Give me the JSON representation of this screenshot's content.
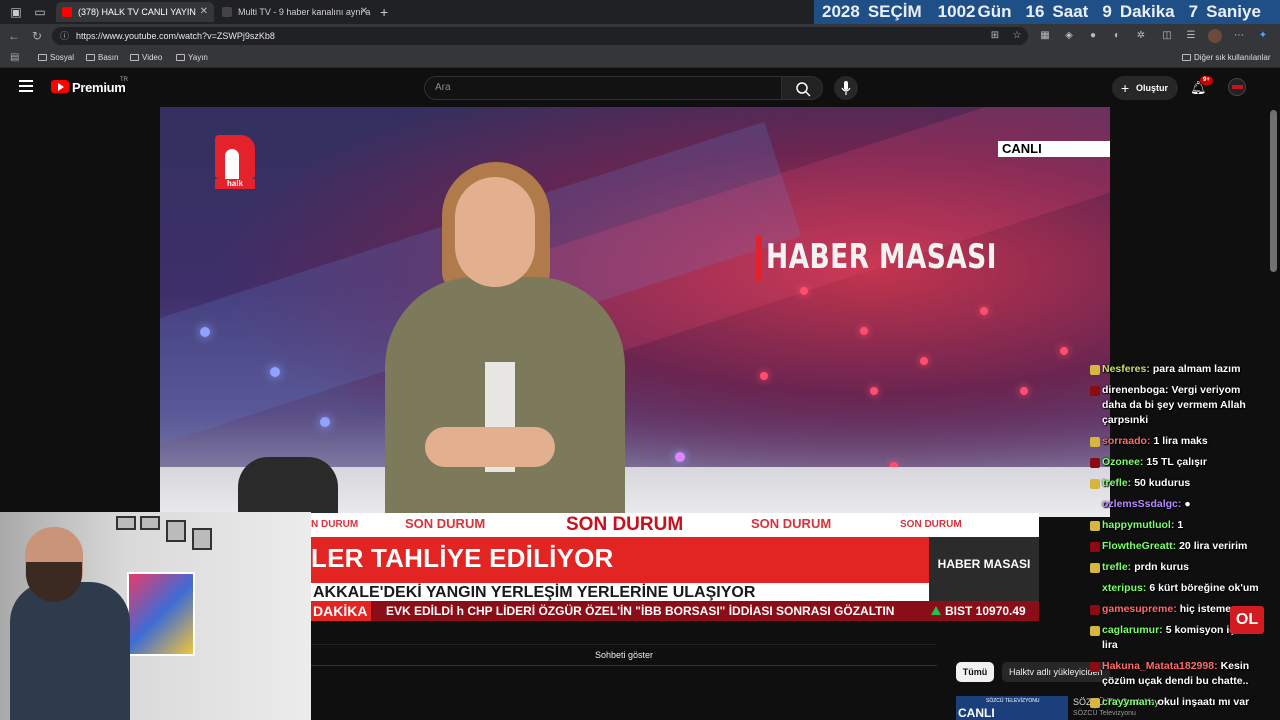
{
  "browser": {
    "tabs": [
      {
        "title": "(378) HALK TV CANLI YAYIN",
        "active": true,
        "favicon_color": "#ff0000"
      },
      {
        "title": "Multi TV - 9 haber kanalını aynı a",
        "active": false,
        "favicon_color": "#333333"
      }
    ],
    "new_tab": "+",
    "url": "https://www.youtube.com/watch?v=ZSWPj9szKb8",
    "bookmarks": [
      "Sosyal",
      "Basın",
      "Video",
      "Yayın"
    ],
    "other_bookmarks": "Diğer sık kullanılanlar"
  },
  "countdown": {
    "year": "2028",
    "label": "SEÇİM",
    "days": "1002",
    "days_label": "Gün",
    "hours": "16",
    "hours_label": "Saat",
    "minutes": "9",
    "minutes_label": "Dakika",
    "seconds": "7",
    "seconds_label": "Saniye"
  },
  "youtube": {
    "brand": "Premium",
    "region": "TR",
    "search_placeholder": "Ara",
    "create_label": "Oluştur",
    "notifications": "9+",
    "show_chat": "Sohbeti göster",
    "chips": [
      "Tümü",
      "Halktv adlı yükleyiciden"
    ],
    "recommendation": {
      "thumb_text": "CANLI",
      "thumb_small": "SÖZCÜ TELEVİZYONU",
      "title": "SÖZCÜ TV Canlı Yayını ᐧ",
      "channel": "SÖZCÜ Televizyonu"
    }
  },
  "broadcast": {
    "logo_word": "halk",
    "live_label": "CANLI",
    "program": "HABER MASASI",
    "son_durum": [
      "N DURUM",
      "SON DURUM",
      "SON DURUM",
      "SON DURUM",
      "SON DURUM"
    ],
    "headline": "LER TAHLİYE EDİLİYOR",
    "subline": "AKKALE'DEKİ YANGIN YERLEŞİM YERLERİNE ULAŞIYOR",
    "lower_logo": "HABER MASASI",
    "ticker_label": "DAKİKA",
    "ticker_text": "EVK EDİLDİ   h   CHP LİDERİ ÖZGÜR ÖZEL'İN \"İBB BORSASI\" İDDİASI SONRASI GÖZALTIN",
    "bist": "BIST 10970.49"
  },
  "chat": [
    {
      "user": "Nesferes:",
      "text": "para almam lazım",
      "badge": "gold",
      "color": "#c6e06a"
    },
    {
      "user": "direnenboga:",
      "text": "Vergi veriyom daha da bi şey vermem Allah çarpsınki",
      "badge": "red",
      "color": "#ffffff"
    },
    {
      "user": "sorraado:",
      "text": "1 lira maks",
      "badge": "gold",
      "color": "#ff6b6b"
    },
    {
      "user": "Ozonee:",
      "text": "15 TL çalışır",
      "badge": "red",
      "color": "#7cff6b"
    },
    {
      "user": "trefle:",
      "text": "50 kudurus",
      "badge": "gold",
      "color": "#7cff6b"
    },
    {
      "user": "ozlemsSsdalgc:",
      "text": "●",
      "badge": "none",
      "color": "#b78bff"
    },
    {
      "user": "happymutluol:",
      "text": "1",
      "badge": "gold",
      "color": "#7cff6b"
    },
    {
      "user": "FlowtheGreatt:",
      "text": "20 lira veririm",
      "badge": "red",
      "color": "#7cff6b"
    },
    {
      "user": "trefle:",
      "text": "prdn kurus",
      "badge": "gold",
      "color": "#7cff6b"
    },
    {
      "user": "xteripus:",
      "text": "6 kürt böreğine ok'um",
      "badge": "none",
      "color": "#7cff6b"
    },
    {
      "user": "gamesupreme:",
      "text": "hiç istemem",
      "badge": "red",
      "color": "#ff6b6b"
    },
    {
      "user": "caglarumur:",
      "text": "5 komisyon için 1 lira",
      "badge": "gold",
      "color": "#7cff6b"
    },
    {
      "user": "Hakuna_Matata182998:",
      "text": "Kesin çözüm uçak dendi bu chatte..",
      "badge": "red",
      "color": "#ff6b6b"
    },
    {
      "user": "crayyman:",
      "text": "okul inşaatı mı var",
      "badge": "gold",
      "color": "#7cff6b"
    }
  ],
  "overlay_badge": "OL"
}
